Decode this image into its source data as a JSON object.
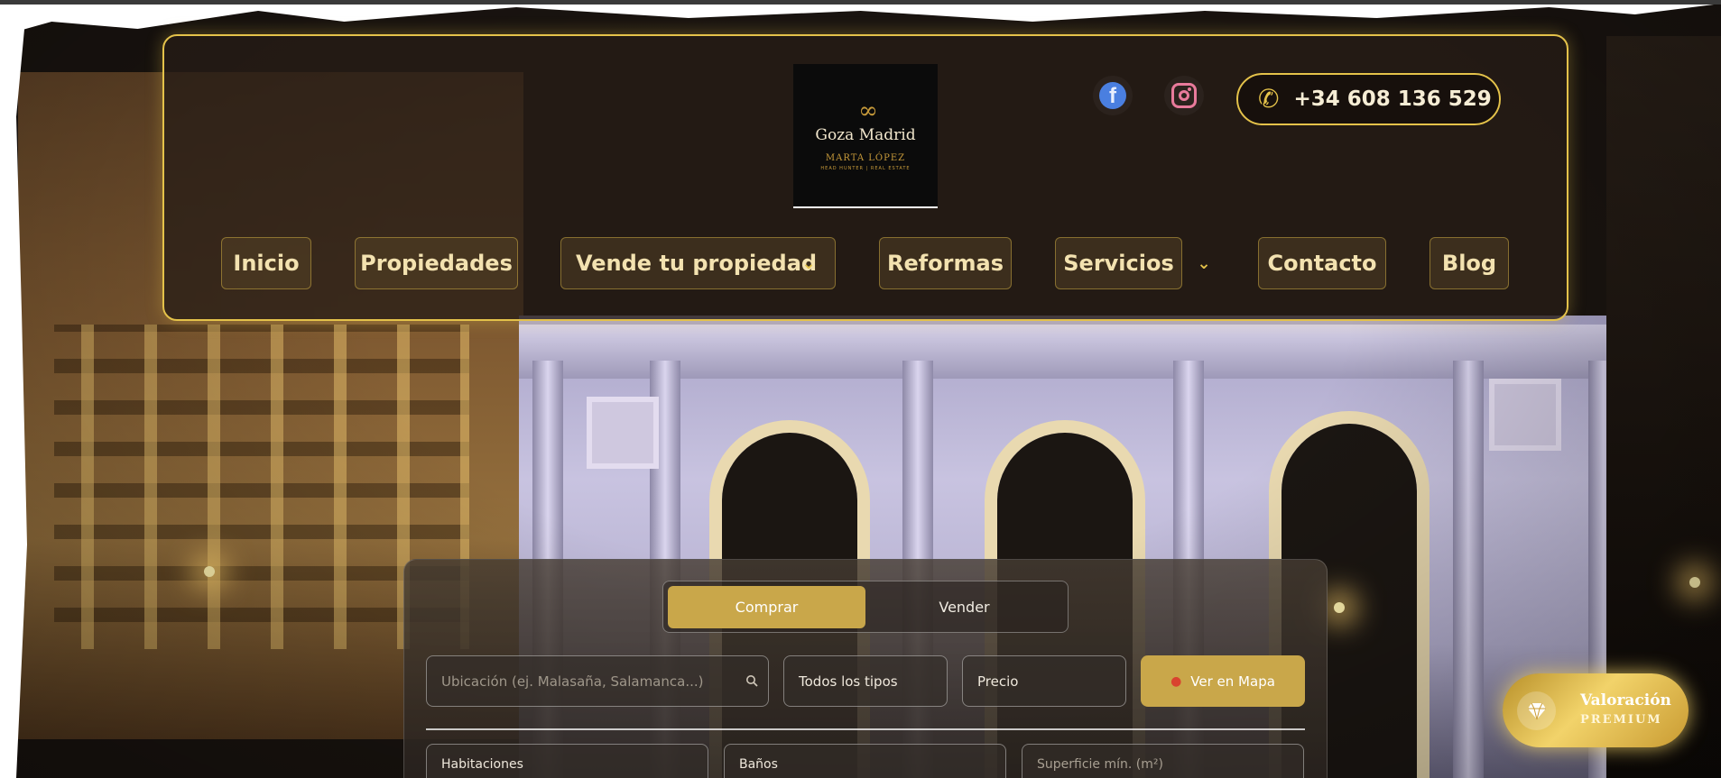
{
  "header": {
    "logo": {
      "symbol": "∞",
      "title": "Goza Madrid",
      "subtitle": "MARTA LÓPEZ",
      "tagline": "HEAD HUNTER | REAL ESTATE"
    },
    "social": {
      "facebook_icon": "facebook-icon",
      "instagram_icon": "instagram-icon"
    },
    "phone": "+34 608 136 529",
    "accent_color": "#e4c24a"
  },
  "nav": {
    "items": [
      {
        "label": "Inicio"
      },
      {
        "label": "Propiedades"
      },
      {
        "label": "Vende tu propiedad"
      },
      {
        "label": "Reformas"
      },
      {
        "label": "Servicios"
      },
      {
        "label": "Contacto"
      },
      {
        "label": "Blog"
      }
    ]
  },
  "search": {
    "tabs": {
      "buy": "Comprar",
      "sell": "Vender"
    },
    "location_placeholder": "Ubicación (ej. Malasaña, Salamanca...)",
    "type_value": "Todos los tipos",
    "price_value": "Precio",
    "map_button": "Ver en Mapa",
    "rooms_label": "Habitaciones",
    "baths_label": "Baños",
    "area_placeholder": "Superficie mín. (m²)",
    "button_color": "#c9a74a"
  },
  "premium": {
    "title": "Valoración",
    "subtitle": "PREMIUM"
  }
}
